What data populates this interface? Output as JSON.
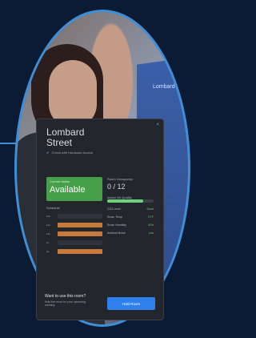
{
  "wall": {
    "label": "Lombard"
  },
  "panel": {
    "room_name_line1": "Lombard",
    "room_name_line2": "Street",
    "subline": "Check with Hardware Access",
    "status_small": "Current status",
    "status": "Available",
    "schedule_header": "Schedule",
    "slots": [
      "10a",
      "11a",
      "12p",
      "1p",
      "2p"
    ],
    "right": {
      "occupancy_label": "Room Occupancy",
      "occupancy_value": "0 / 12",
      "air_quality_label": "Indoor Air Quality",
      "co2_label": "CO2 Level",
      "co2_value": "Good",
      "rows": [
        {
          "label": "Room Temp",
          "value": "71°F"
        },
        {
          "label": "Room Humidity",
          "value": "42%"
        },
        {
          "label": "Ambient Noise",
          "value": "Low"
        }
      ]
    },
    "footer": {
      "question": "Want to use this room?",
      "sub": "Hold the room for your upcoming meeting",
      "button": "Hold Room"
    }
  }
}
